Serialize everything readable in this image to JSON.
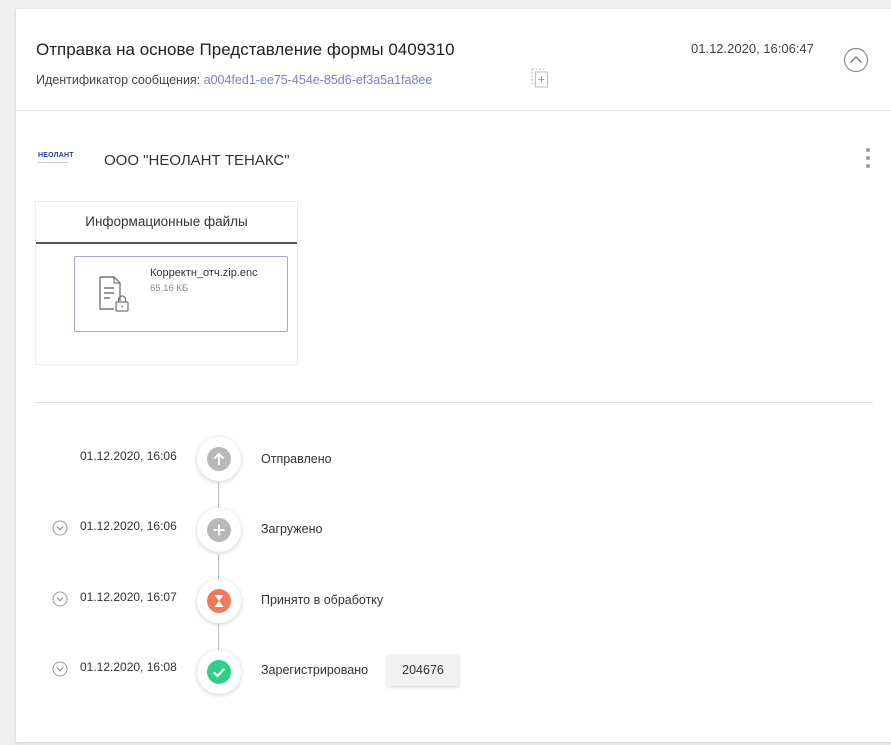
{
  "header": {
    "title": "Отправка на основе Представление формы 0409310",
    "message_id_label": "Идентификатор сообщения: ",
    "message_id_value": "a004fed1-ee75-454e-85d6-ef3a5a1fa8ee",
    "date": "01.12.2020, 16:06:47",
    "collapse_icon": "chevron-up-icon",
    "copy_icon": "copy-icon"
  },
  "organization": {
    "logo_text": "НЕОЛАНТ",
    "name": "ООО \"НЕОЛАНТ ТЕНАКС\"",
    "menu_icon": "kebab-menu-icon"
  },
  "files": {
    "tab_label": "Информационные файлы",
    "items": [
      {
        "name": "Корректн_отч.zip.enc",
        "size": "65.16 КБ",
        "icon": "encrypted-file-icon"
      }
    ]
  },
  "timeline": [
    {
      "date": "01.12.2020, 16:06",
      "label": "Отправлено",
      "status": "sent",
      "icon": "arrow-up-icon",
      "color": "#b8b8b8",
      "expandable": false
    },
    {
      "date": "01.12.2020, 16:06",
      "label": "Загружено",
      "status": "uploaded",
      "icon": "plus-icon",
      "color": "#b8b8b8",
      "expandable": true
    },
    {
      "date": "01.12.2020, 16:07",
      "label": "Принято в обработку",
      "status": "processing",
      "icon": "hourglass-icon",
      "color": "#ef7b5e",
      "expandable": true
    },
    {
      "date": "01.12.2020, 16:08",
      "label": "Зарегистрировано",
      "status": "registered",
      "icon": "check-icon",
      "color": "#2fcf8a",
      "expandable": true,
      "badge": "204676"
    }
  ],
  "colors": {
    "accent_link": "#7c7fc9",
    "file_border": "#a4a6d8",
    "logo": "#2a3d8f"
  }
}
